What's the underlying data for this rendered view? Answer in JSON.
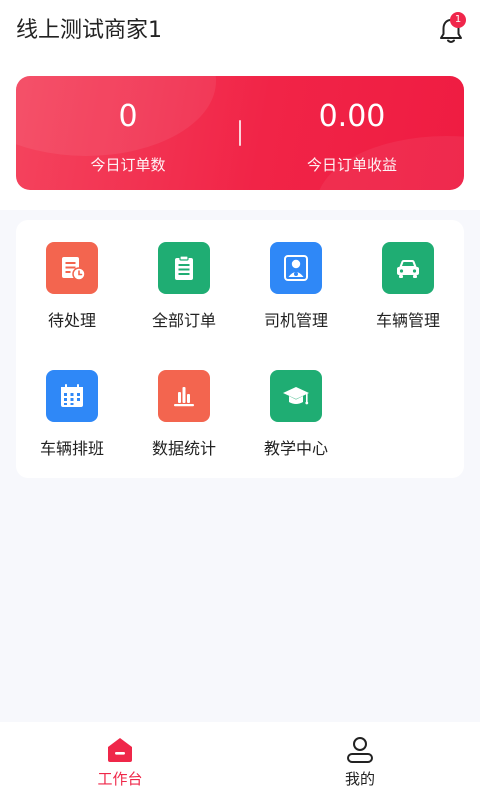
{
  "header": {
    "title": "线上测试商家1",
    "notification_count": "1"
  },
  "stats": {
    "today_orders_value": "0",
    "today_orders_label": "今日订单数",
    "today_revenue_value": "0.00",
    "today_revenue_label": "今日订单收益"
  },
  "menu": {
    "items": [
      {
        "label": "待处理",
        "icon": "pending-doc-icon",
        "color": "#f3654f"
      },
      {
        "label": "全部订单",
        "icon": "clipboard-icon",
        "color": "#1fad73"
      },
      {
        "label": "司机管理",
        "icon": "driver-icon",
        "color": "#2f88f7"
      },
      {
        "label": "车辆管理",
        "icon": "car-icon",
        "color": "#1fad73"
      },
      {
        "label": "车辆排班",
        "icon": "calendar-icon",
        "color": "#2f88f7"
      },
      {
        "label": "数据统计",
        "icon": "bar-chart-icon",
        "color": "#f3654f"
      },
      {
        "label": "教学中心",
        "icon": "graduation-cap-icon",
        "color": "#1fad73"
      }
    ]
  },
  "tabbar": {
    "workbench_label": "工作台",
    "mine_label": "我的",
    "active_color": "#ef2749"
  }
}
